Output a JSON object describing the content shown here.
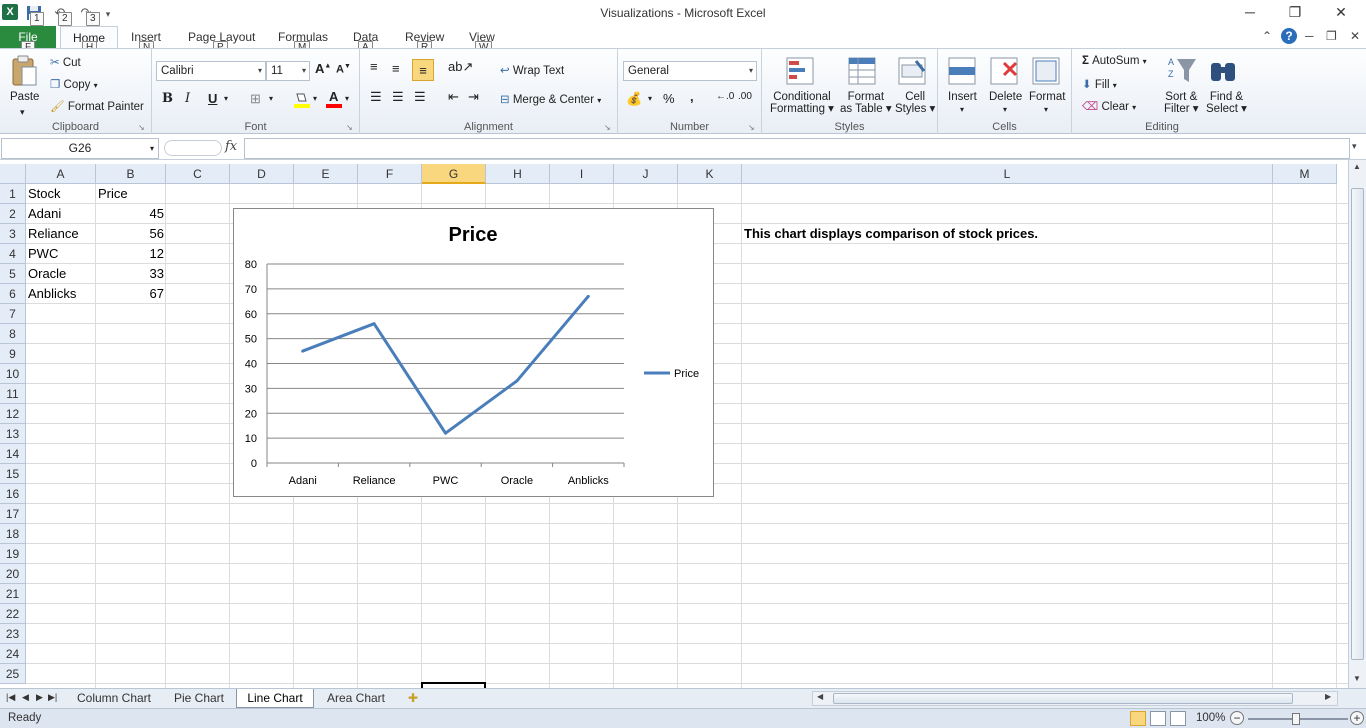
{
  "window": {
    "title": "Visualizations  -  Microsoft Excel",
    "app_icon_glyph": "X",
    "keytips": {
      "save": "1",
      "undo": "2",
      "redo": "3"
    }
  },
  "ribbon_tabs": [
    {
      "label": "File",
      "keytip": "F"
    },
    {
      "label": "Home",
      "keytip": "H"
    },
    {
      "label": "Insert",
      "keytip": "N"
    },
    {
      "label": "Page Layout",
      "keytip": "P"
    },
    {
      "label": "Formulas",
      "keytip": "M"
    },
    {
      "label": "Data",
      "keytip": "A"
    },
    {
      "label": "Review",
      "keytip": "R"
    },
    {
      "label": "View",
      "keytip": "W"
    }
  ],
  "ribbon": {
    "clipboard": {
      "label": "Clipboard",
      "paste": "Paste",
      "cut": "Cut",
      "copy": "Copy",
      "format_painter": "Format Painter"
    },
    "font": {
      "label": "Font",
      "family": "Calibri",
      "size": "11",
      "bold": "B",
      "italic": "I",
      "underline": "U"
    },
    "alignment": {
      "label": "Alignment",
      "wrap_text": "Wrap Text",
      "merge_center": "Merge & Center"
    },
    "number": {
      "label": "Number",
      "format": "General",
      "percent": "%",
      "comma": ","
    },
    "styles": {
      "label": "Styles",
      "conditional": [
        "Conditional",
        "Formatting"
      ],
      "format_table": [
        "Format",
        "as Table"
      ],
      "cell_styles": [
        "Cell",
        "Styles"
      ]
    },
    "cells": {
      "label": "Cells",
      "insert": "Insert",
      "delete": "Delete",
      "format": "Format"
    },
    "editing": {
      "label": "Editing",
      "autosum": "AutoSum",
      "fill": "Fill",
      "clear": "Clear",
      "sort_filter": [
        "Sort &",
        "Filter"
      ],
      "find_select": [
        "Find &",
        "Select"
      ]
    }
  },
  "formula_bar": {
    "name_box": "G26",
    "fx": "fx",
    "formula": ""
  },
  "sheet": {
    "columns": [
      "A",
      "B",
      "C",
      "D",
      "E",
      "F",
      "G",
      "H",
      "I",
      "J",
      "K",
      "L",
      "M"
    ],
    "selected_column": "G",
    "rows": [
      "1",
      "2",
      "3",
      "4",
      "5",
      "6",
      "7",
      "8",
      "9",
      "10",
      "11",
      "12",
      "13",
      "14",
      "15",
      "16",
      "17",
      "18",
      "19",
      "20",
      "21",
      "22",
      "23",
      "24",
      "25"
    ],
    "headers": [
      "Stock",
      "Price"
    ],
    "data": [
      {
        "stock": "Adani",
        "price": "45"
      },
      {
        "stock": "Reliance",
        "price": "56"
      },
      {
        "stock": "PWC",
        "price": "12"
      },
      {
        "stock": "Oracle",
        "price": "33"
      },
      {
        "stock": "Anblicks",
        "price": "67"
      }
    ],
    "note": "This chart displays comparison of stock prices."
  },
  "chart_data": {
    "type": "line",
    "title": "Price",
    "categories": [
      "Adani",
      "Reliance",
      "PWC",
      "Oracle",
      "Anblicks"
    ],
    "series": [
      {
        "name": "Price",
        "values": [
          45,
          56,
          12,
          33,
          67
        ],
        "color": "#4a7ebb"
      }
    ],
    "ylim": [
      0,
      80
    ],
    "yticks": [
      0,
      10,
      20,
      30,
      40,
      50,
      60,
      70,
      80
    ],
    "grid": true,
    "legend": "right"
  },
  "sheet_tabs": [
    "Column Chart",
    "Pie Chart",
    "Line Chart",
    "Area Chart"
  ],
  "active_sheet_tab": "Line Chart",
  "status": {
    "ready": "Ready",
    "zoom": "100%"
  }
}
